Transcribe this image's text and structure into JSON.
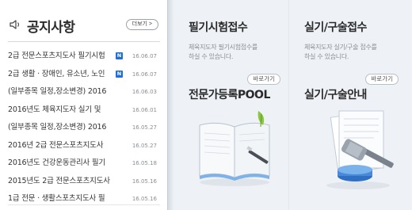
{
  "notice": {
    "title": "공지사항",
    "more_label": "더보기 >",
    "items": [
      {
        "text": "2급 전문스포츠지도사 필기시험",
        "date": "16.06.07",
        "new": true
      },
      {
        "text": "2급 생활 · 장애인, 유소년, 노인",
        "date": "16.06.07",
        "new": true
      },
      {
        "text": "(일부종목 일정,장소변경) 2016",
        "date": "16.06.03",
        "new": false
      },
      {
        "text": "2016년도 체육지도자 실기 및",
        "date": "16.06.01",
        "new": false
      },
      {
        "text": "(일부종목 일정,장소변경) 2016",
        "date": "16.05.27",
        "new": false
      },
      {
        "text": "2016년 2급 전문스포츠지도사",
        "date": "16.05.27",
        "new": false
      },
      {
        "text": "2016년도 건강운동관리사 필기",
        "date": "16.05.18",
        "new": false
      },
      {
        "text": "2015년도 2급 전문스포츠지도사",
        "date": "16.05.16",
        "new": false
      },
      {
        "text": "1급 전문 · 생활스포츠지도사 필",
        "date": "16.05.16",
        "new": false
      }
    ],
    "new_badge": "N"
  },
  "cards": {
    "written_exam": {
      "title": "필기시험접수",
      "desc_line1": "체육지도자 필기시험접수를",
      "desc_line2": "하실 수 있습니다."
    },
    "practical_exam": {
      "title": "실기/구술접수",
      "desc_line1": "체육지도자 실기/구술 접수를",
      "desc_line2": "하실 수 있습니다."
    },
    "pro_register": {
      "title": "전문가등록POOL",
      "go_label": "바로가기"
    },
    "practical_guide": {
      "title": "실기/구술안내",
      "go_label": "바로가기"
    }
  },
  "colors": {
    "accent_blue": "#1f6fd6",
    "title_text": "#2a2a2a",
    "muted_text": "#8a8f95"
  },
  "icons": [
    "speaker-icon",
    "open-book-icon",
    "judge-gavel-icon",
    "new-badge"
  ]
}
